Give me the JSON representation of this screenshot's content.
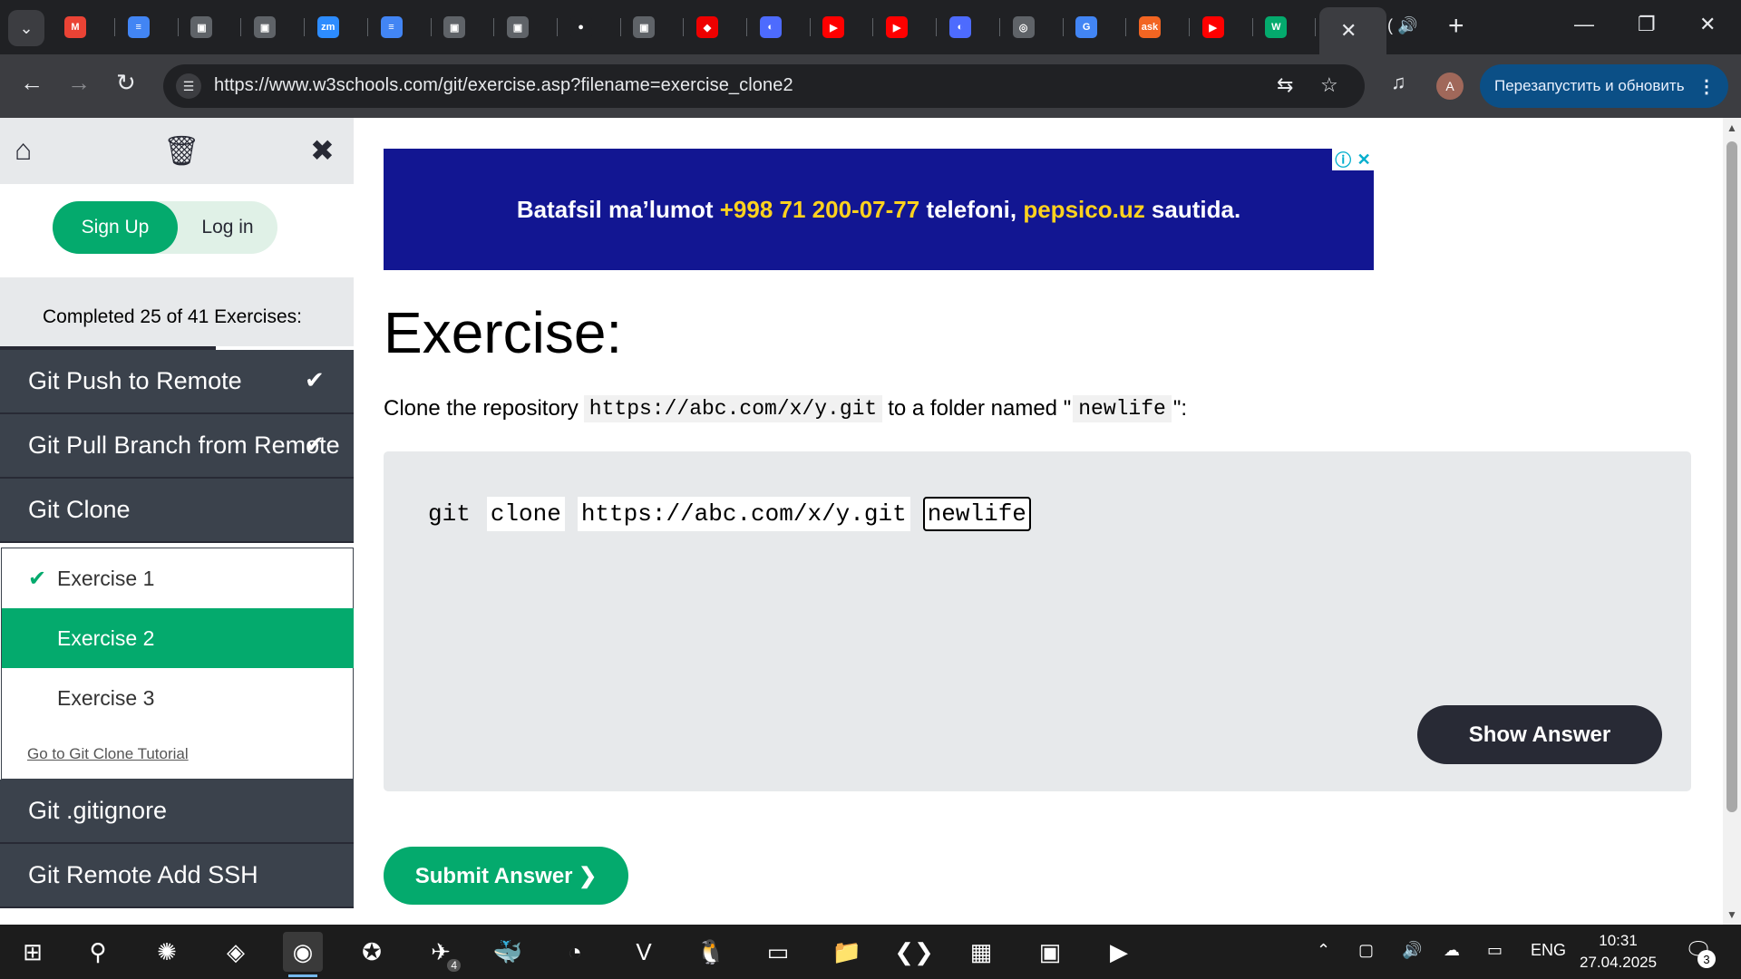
{
  "browser": {
    "url": "https://www.w3schools.com/git/exercise.asp?filename=exercise_clone2",
    "restart_label": "Перезапустить и обновить",
    "profile_initial": "A",
    "tabs": [
      {
        "icon": "gmail-icon",
        "glyph": "M",
        "color": "#ea4335"
      },
      {
        "icon": "docs-icon",
        "glyph": "≡",
        "color": "#4285f4"
      },
      {
        "icon": "classroom-icon",
        "glyph": "▣",
        "color": "#5f6368"
      },
      {
        "icon": "classroom-icon",
        "glyph": "▣",
        "color": "#5f6368"
      },
      {
        "icon": "zoom-icon",
        "glyph": "zm",
        "color": "#2d8cff"
      },
      {
        "icon": "docs-icon",
        "glyph": "≡",
        "color": "#4285f4"
      },
      {
        "icon": "classroom-icon",
        "glyph": "▣",
        "color": "#5f6368"
      },
      {
        "icon": "classroom-icon",
        "glyph": "▣",
        "color": "#5f6368"
      },
      {
        "icon": "github-icon",
        "glyph": "●",
        "color": "#202124"
      },
      {
        "icon": "classroom-icon",
        "glyph": "▣",
        "color": "#5f6368"
      },
      {
        "icon": "redhat-icon",
        "glyph": "◆",
        "color": "#ee0000"
      },
      {
        "icon": "deepseek-icon",
        "glyph": "◐",
        "color": "#4d6bfe"
      },
      {
        "icon": "youtube-icon",
        "glyph": "▶",
        "color": "#ff0000"
      },
      {
        "icon": "youtube-icon",
        "glyph": "▶",
        "color": "#ff0000"
      },
      {
        "icon": "deepseek-icon",
        "glyph": "◐",
        "color": "#4d6bfe"
      },
      {
        "icon": "globe-icon",
        "glyph": "◎",
        "color": "#5f6368"
      },
      {
        "icon": "translate-icon",
        "glyph": "G",
        "color": "#4285f4"
      },
      {
        "icon": "ask-icon",
        "glyph": "ask",
        "color": "#f26522"
      },
      {
        "icon": "youtube-icon",
        "glyph": "▶",
        "color": "#ff0000"
      },
      {
        "icon": "w3schools-icon",
        "glyph": "W",
        "color": "#04aa6d"
      }
    ]
  },
  "sidebar": {
    "signup_label": "Sign Up",
    "login_label": "Log in",
    "progress_text": "Completed 25 of 41 Exercises:",
    "progress_fraction": 0.61,
    "menu_top": [
      {
        "label": "Git Push to Remote",
        "done": true
      },
      {
        "label": "Git Pull Branch from Remote",
        "done": true
      },
      {
        "label": "Git Clone",
        "done": false
      }
    ],
    "exercises": [
      {
        "label": "Exercise 1",
        "done": true
      },
      {
        "label": "Exercise 2",
        "done": false
      },
      {
        "label": "Exercise 3",
        "done": false
      }
    ],
    "tutorial_link": "Go to Git Clone Tutorial",
    "menu_bottom": [
      {
        "label": "Git .gitignore"
      },
      {
        "label": "Git Remote Add SSH"
      }
    ]
  },
  "ad": {
    "part1": "Batafsil ma’lumot ",
    "phone": "+998 71 200-07-77",
    "part2": " telefoni, ",
    "site": "pepsico.uz",
    "part3": " sautida."
  },
  "exercise": {
    "title": "Exercise:",
    "instr_prefix": "Clone the repository",
    "instr_repo": "https://abc.com/x/y.git",
    "instr_mid": "to a folder named \"",
    "instr_folder": "newlife",
    "instr_suffix": "\":",
    "code_cmd": "git",
    "code_sub": "clone",
    "code_repo": "https://abc.com/x/y.git",
    "code_answer": "newlife",
    "show_answer_label": "Show Answer",
    "submit_label": "Submit Answer ❯"
  },
  "taskbar": {
    "lang": "ENG",
    "time": "10:31",
    "date": "27.04.2025",
    "notifications": "3",
    "telegram_badge": "4"
  }
}
